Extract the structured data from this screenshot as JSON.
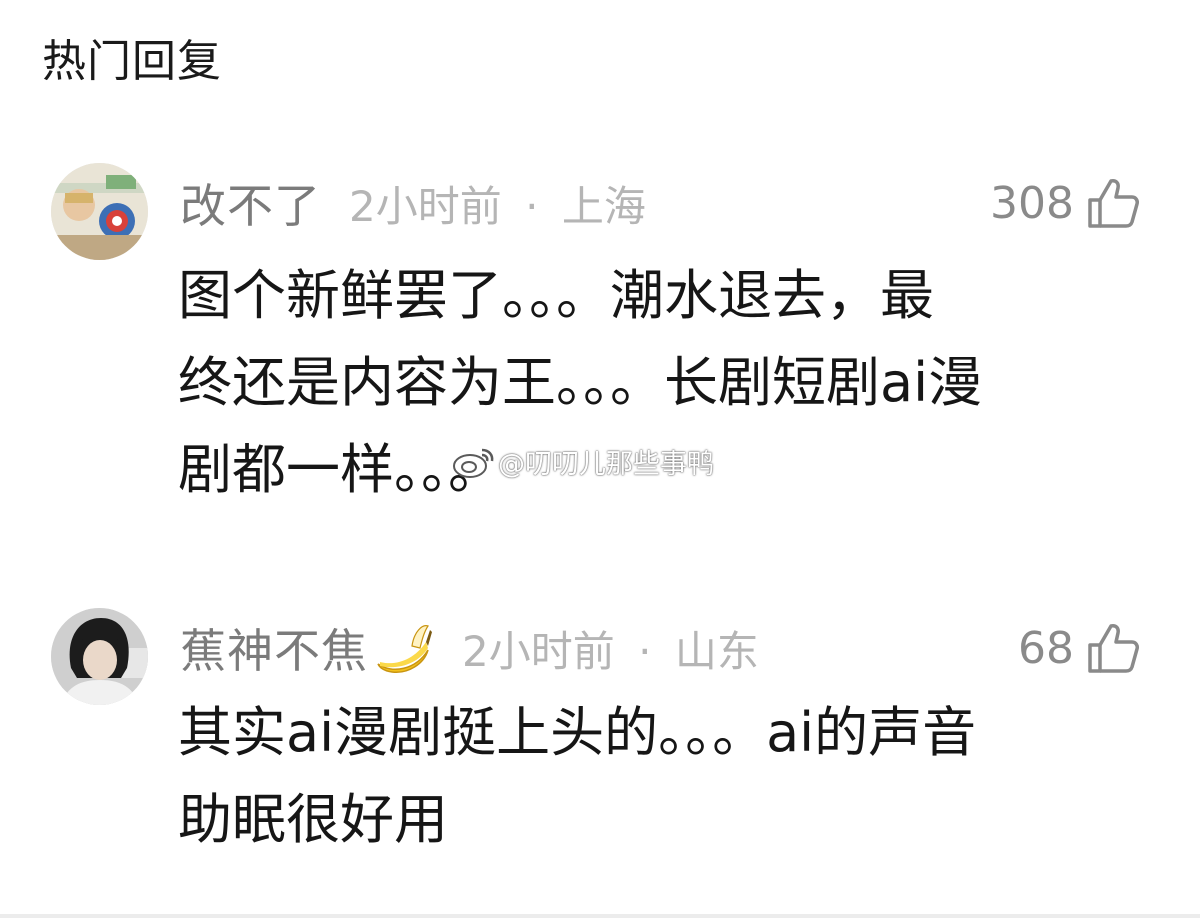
{
  "section": {
    "title": "热门回复"
  },
  "comments": [
    {
      "username": "改不了",
      "time": "2小时前",
      "separator": "·",
      "location": "上海",
      "likes": "308",
      "text": "图个新鲜罢了。。。潮水退去，最\n终还是内容为王。。。长剧短剧ai漫\n剧都一样。。。",
      "avatar_icon": "cartoon-avatar-icon"
    },
    {
      "username": "蕉神不焦",
      "username_emoji": "banana-emoji",
      "time": "2小时前",
      "separator": "·",
      "location": "山东",
      "likes": "68",
      "text": "其实ai漫剧挺上头的。。。ai的声音\n助眠很好用",
      "avatar_icon": "person-photo-avatar-icon"
    }
  ],
  "watermark": {
    "text": "@叨叨儿那些事鸭",
    "icon": "weibo-logo-icon"
  },
  "colors": {
    "username": "#7b7b7b",
    "meta": "#b5b5b5",
    "body_text": "#161616",
    "like_count": "#8a8a8a"
  }
}
